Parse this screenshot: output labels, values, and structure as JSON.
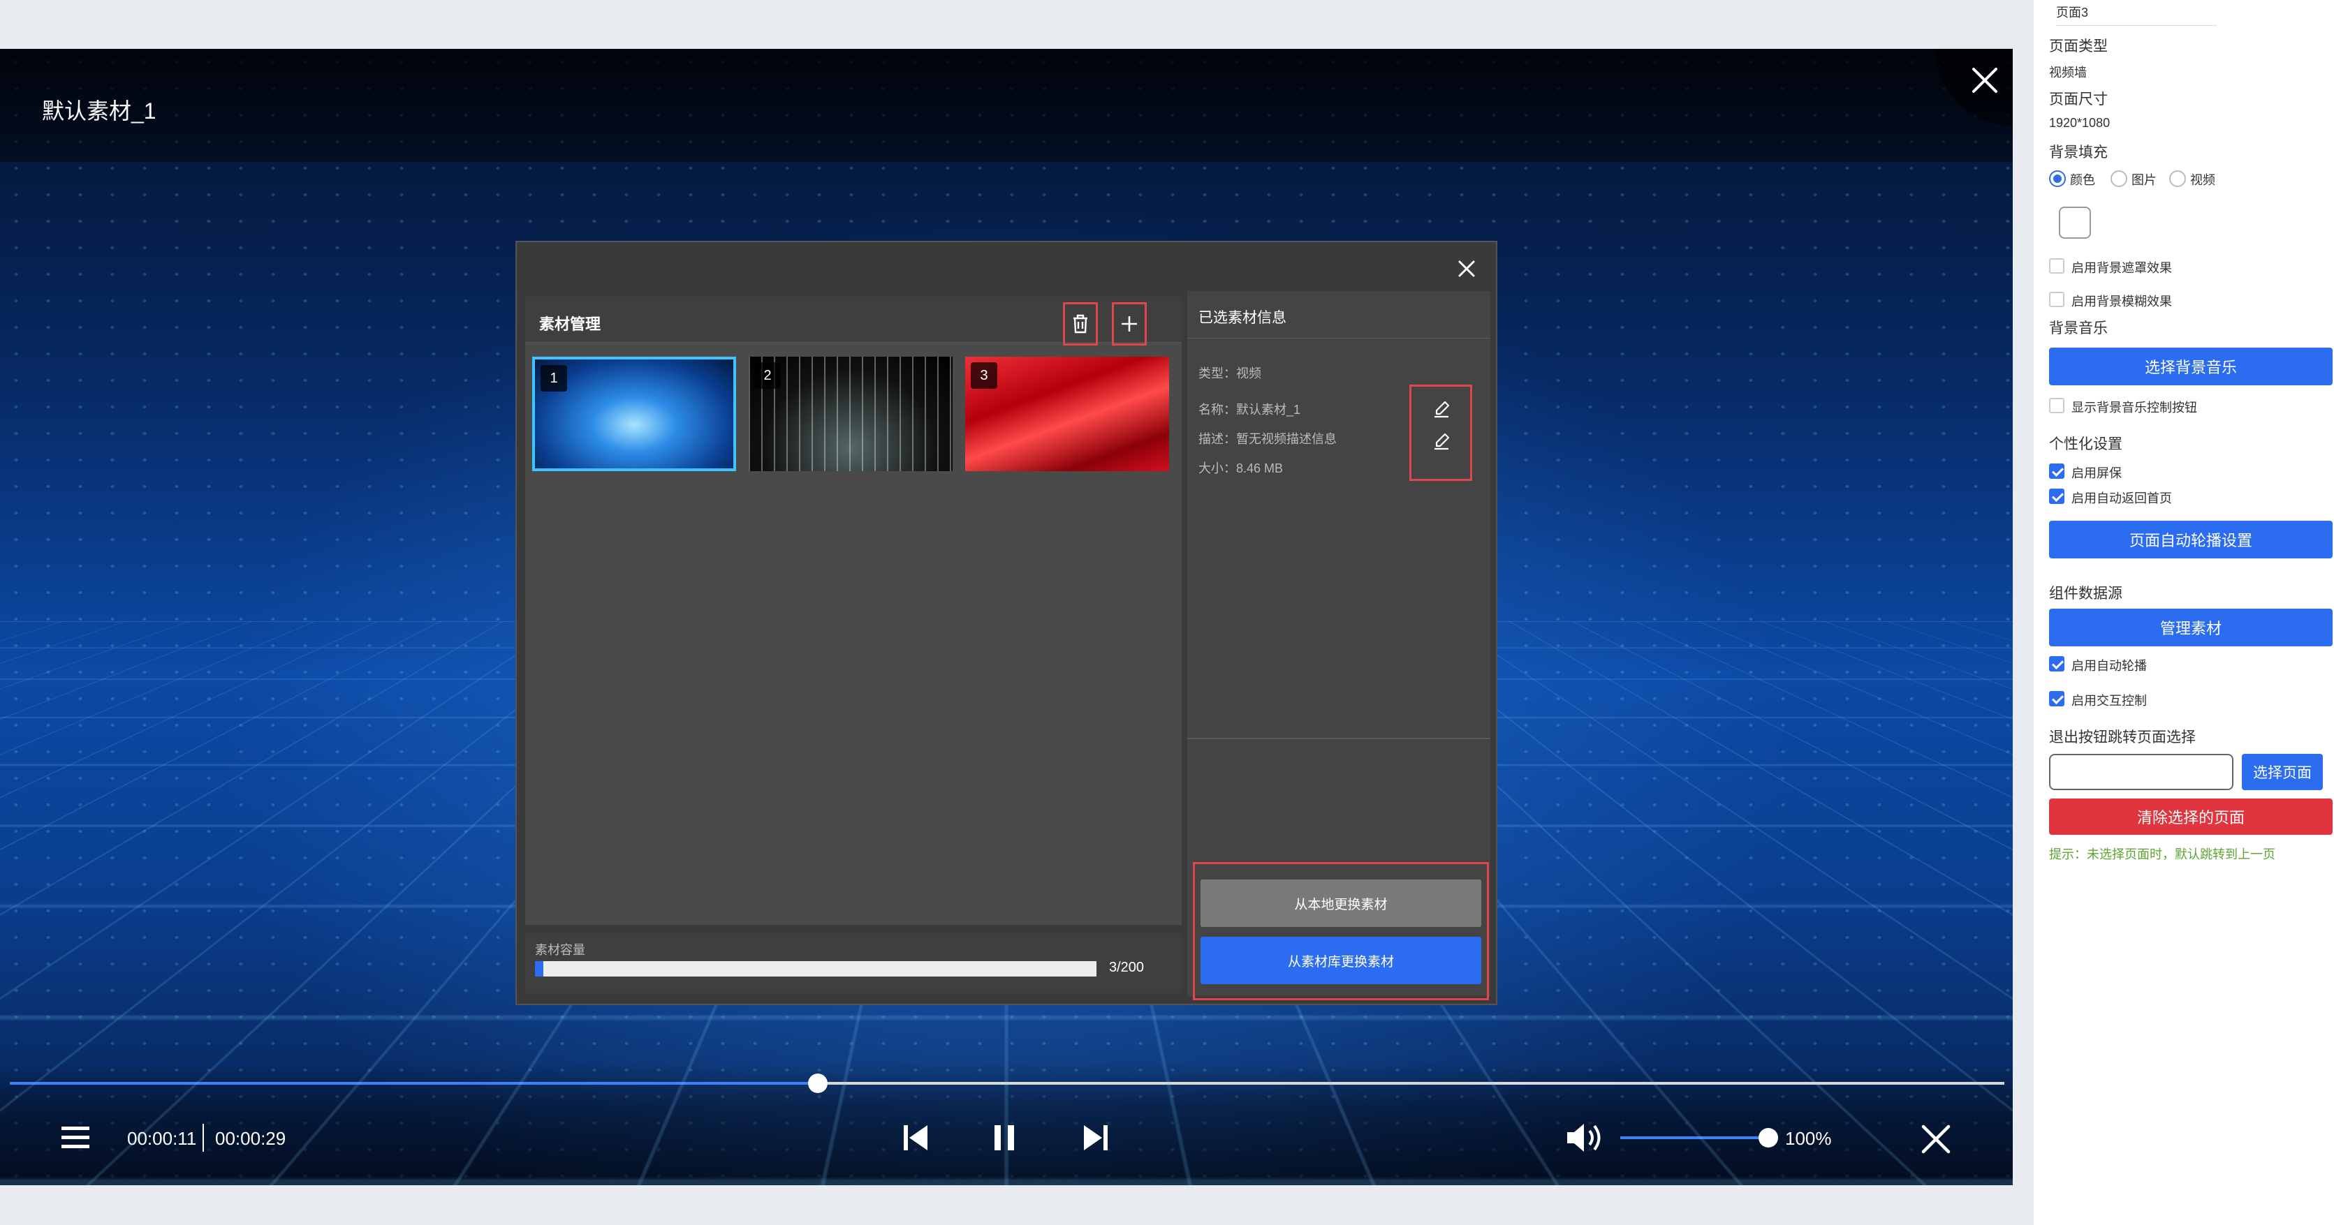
{
  "video": {
    "title": "默认素材_1",
    "time_current": "00:00:11",
    "time_total": "00:00:29",
    "progress": 0.405,
    "volume_label": "100%",
    "volume_level": 1.0
  },
  "modal": {
    "left_title": "素材管理",
    "thumbnails": [
      {
        "num": "1",
        "selected": true
      },
      {
        "num": "2",
        "selected": false
      },
      {
        "num": "3",
        "selected": false
      }
    ],
    "capacity_label": "素材容量",
    "capacity_text": "3/200",
    "capacity_fraction": 0.015,
    "right_title": "已选素材信息",
    "info": {
      "type": "类型：视频",
      "name": "名称：默认素材_1",
      "desc": "描述：暂无视频描述信息",
      "size": "大小：8.46 MB"
    },
    "btn_local": "从本地更换素材",
    "btn_library": "从素材库更换素材"
  },
  "sidebar": {
    "page_name": "页面3",
    "page_type_label": "页面类型",
    "page_type_value": "视频墙",
    "page_size_label": "页面尺寸",
    "page_size_value": "1920*1080",
    "bg_fill_label": "背景填充",
    "bg_options": [
      "颜色",
      "图片",
      "视频"
    ],
    "bg_selected": "颜色",
    "bg_mask_label": "启用背景遮罩效果",
    "bg_blur_label": "启用背景模糊效果",
    "bg_music_label": "背景音乐",
    "select_music_btn": "选择背景音乐",
    "show_music_ctrl_label": "显示背景音乐控制按钮",
    "personal_label": "个性化设置",
    "screensaver_label": "启用屏保",
    "auto_home_label": "启用自动返回首页",
    "auto_carousel_btn": "页面自动轮播设置",
    "datasource_label": "组件数据源",
    "manage_material_btn": "管理素材",
    "auto_play_label": "启用自动轮播",
    "interactive_label": "启用交互控制",
    "exit_jump_label": "退出按钮跳转页面选择",
    "select_page_btn": "选择页面",
    "clear_page_btn": "清除选择的页面",
    "hint": "提示：未选择页面时，默认跳转到上一页"
  }
}
